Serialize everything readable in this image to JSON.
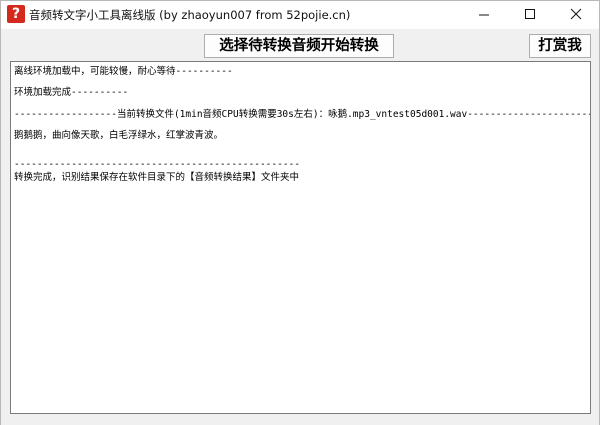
{
  "window": {
    "title": "音频转文字小工具离线版 (by zhaoyun007 from 52pojie.cn)",
    "app_icon_glyph": "?",
    "app_icon_color": "#d42a1e",
    "controls": {
      "minimize": "minimize-icon",
      "maximize": "maximize-icon",
      "close": "close-icon"
    }
  },
  "toolbar": {
    "convert_label": "选择待转换音频开始转换",
    "tip_label": "打赏我"
  },
  "log": {
    "lines": [
      "离线环境加载中，可能较慢，耐心等待----------",
      "环境加载完成----------",
      "------------------当前转换文件(1min音频CPU转换需要30s左右)：咏鹅.mp3_vntest05d001.wav--------------------------",
      "鹅鹅鹅，曲向像天歌，白毛浮绿水，红掌波青波。",
      "--------------------------------------------------",
      "转换完成，识别结果保存在软件目录下的【音频转换结果】文件夹中"
    ]
  }
}
